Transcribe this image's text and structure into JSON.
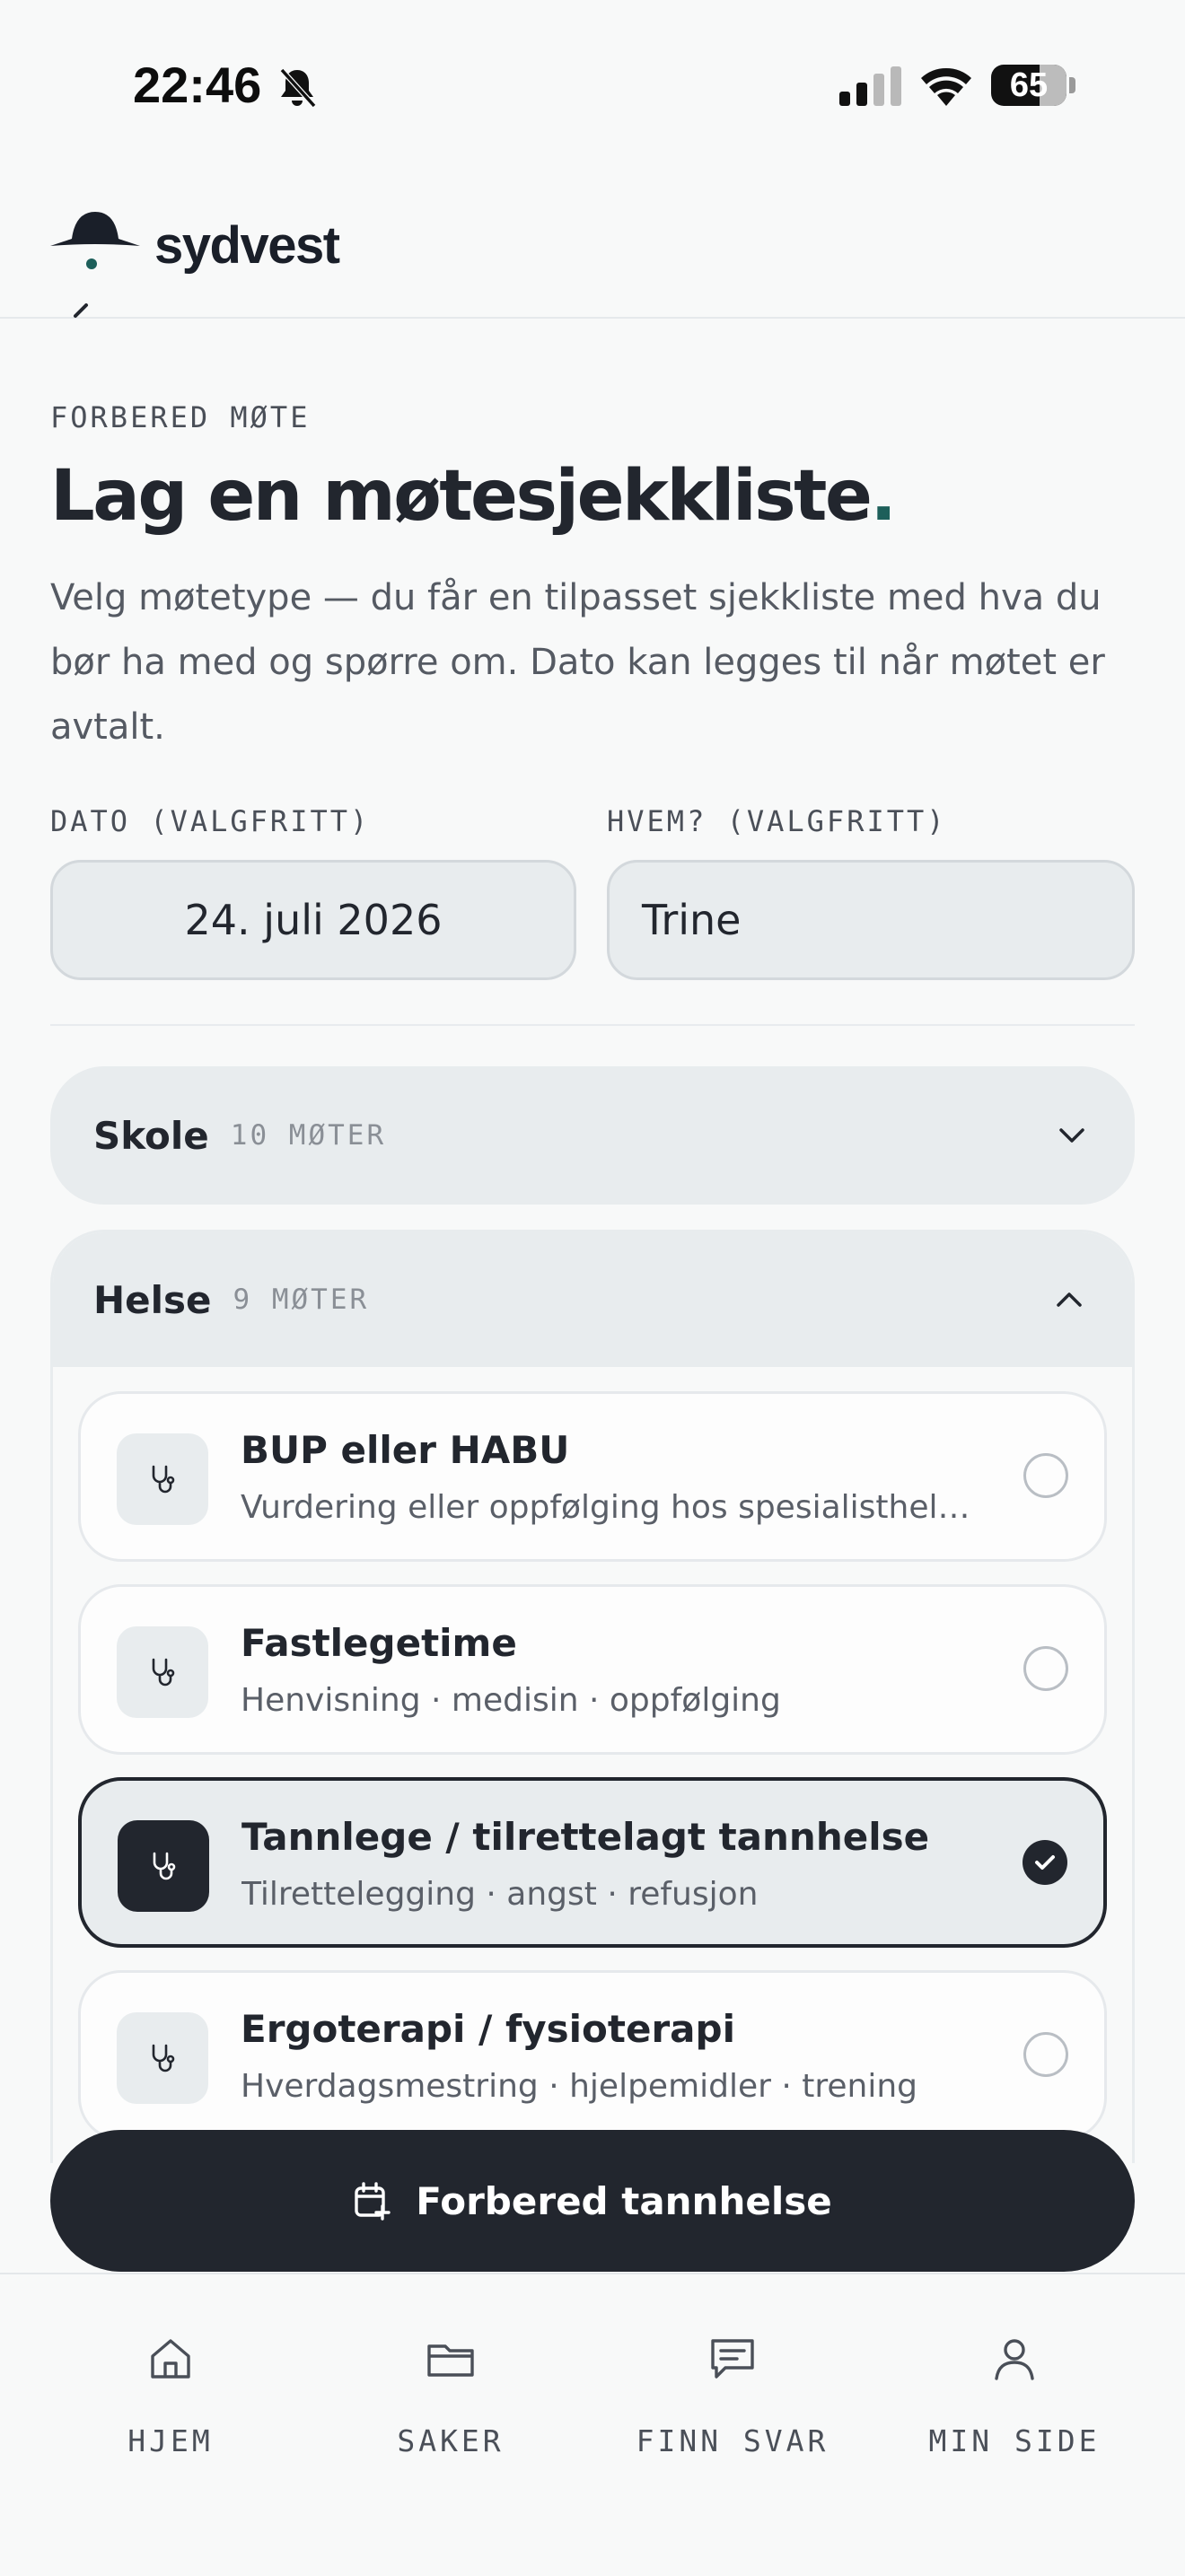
{
  "status_bar": {
    "time": "22:46",
    "battery": "65",
    "icons": [
      "bell-slash-icon",
      "signal-icon",
      "wifi-icon",
      "battery-icon"
    ]
  },
  "header": {
    "brand": "sydvest"
  },
  "page": {
    "eyebrow": "FORBERED MØTE",
    "title": "Lag en møtesjekkliste",
    "title_dot": ".",
    "intro": "Velg møtetype — du får en tilpasset sjekkliste med hva du bør ha med og spørre om. Dato kan legges til når møtet er avtalt."
  },
  "fields": {
    "date_label": "DATO (VALGFRITT)",
    "date_value": "24. juli 2026",
    "who_label": "HVEM? (VALGFRITT)",
    "who_value": "Trine"
  },
  "groups": [
    {
      "title": "Skole",
      "count": "10 MØTER",
      "expanded": false
    },
    {
      "title": "Helse",
      "count": "9 MØTER",
      "expanded": true,
      "items": [
        {
          "title": "BUP eller HABU",
          "subtitle": "Vurdering eller oppfølging hos spesialisthelse…",
          "selected": false
        },
        {
          "title": "Fastlegetime",
          "subtitle": "Henvisning · medisin · oppfølging",
          "selected": false
        },
        {
          "title": "Tannlege / tilrettelagt tannhelse",
          "subtitle": "Tilrettelegging · angst · refusjon",
          "selected": true
        },
        {
          "title": "Ergoterapi / fysioterapi",
          "subtitle": "Hverdagsmestring · hjelpemidler · trening",
          "selected": false
        }
      ]
    }
  ],
  "cta": {
    "label": "Forbered tannhelse"
  },
  "nav": [
    {
      "label": "HJEM",
      "icon": "home-icon"
    },
    {
      "label": "SAKER",
      "icon": "folder-icon"
    },
    {
      "label": "FINN SVAR",
      "icon": "chat-icon"
    },
    {
      "label": "MIN SIDE",
      "icon": "user-icon"
    }
  ],
  "colors": {
    "background": "#f8f9f9",
    "ink": "#22262e",
    "accent_dot": "#1d5f5a",
    "surface": "#e8ecee"
  }
}
